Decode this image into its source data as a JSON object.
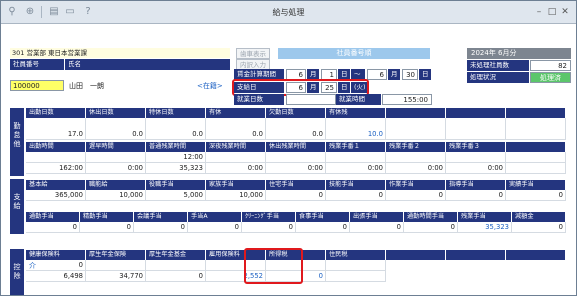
{
  "window": {
    "title": "給与処理"
  },
  "toolbar_icons": [
    "add-user-icon",
    "search-zoom-icon",
    "print-icon",
    "export-icon",
    "help-icon"
  ],
  "employee": {
    "dept": "301 営業部 東日本営業課",
    "code_label": "社員番号",
    "name_label": "氏名",
    "code": "100000",
    "name": "山田　一朗",
    "status_link": "<在籍>"
  },
  "buttons": {
    "rate_display": "歯車表示",
    "ad_input": "内訳入力",
    "sort": "社員番号順"
  },
  "period": {
    "label": "賃金計算期間",
    "from_month": "6",
    "month_unit": "月",
    "from_day": "1",
    "day_unit": "日",
    "tilde": "～",
    "to_month": "6",
    "to_day": "30",
    "pay_label": "支給日",
    "pay_month": "6",
    "pay_day": "25",
    "pay_weekday": "(火)",
    "workdays_label": "就業日数",
    "workhours_label": "就業時間",
    "workhours_value": "155:00"
  },
  "summary": {
    "month": "2024年 6月分",
    "unprocessed_label": "未処理社員数",
    "unprocessed_value": "82",
    "status_label": "処理状況",
    "status_value": "処理済"
  },
  "attendance": {
    "section": "勤怠他",
    "row1_headers": [
      "出勤日数",
      "休出日数",
      "特休日数",
      "有休",
      "欠勤日数",
      "有休残",
      "",
      "",
      ""
    ],
    "row1_values": [
      "17.0",
      "0.0",
      "0.0",
      "0.0",
      "0.0",
      "10.0",
      "",
      "",
      ""
    ],
    "row2_headers": [
      "出勤時間",
      "遅早時間",
      "普通残業時間",
      "深夜残業時間",
      "休出残業時間",
      "残業手番１",
      "残業手番２",
      "残業手番３",
      ""
    ],
    "row2_values": [
      "162:00",
      "0:00",
      "35,323",
      "0:00",
      "0:00",
      "0:00",
      "0:00",
      "0:00",
      ""
    ],
    "row2_sub": [
      "",
      "",
      "12:00",
      "",
      "",
      "",
      "",
      "",
      ""
    ]
  },
  "payment": {
    "section": "支給",
    "row1_headers": [
      "基本給",
      "職能給",
      "役職手当",
      "家族手当",
      "住宅手当",
      "技能手当",
      "作業手当",
      "指導手当",
      "実績手当"
    ],
    "row1_values": [
      "365,000",
      "10,000",
      "5,000",
      "10,000",
      "0",
      "0",
      "0",
      "0",
      "0"
    ],
    "row2_headers": [
      "通勤手当",
      "精勤手当",
      "会議手当",
      "手当A",
      "ｸﾘｰﾆﾝｸﾞ手当",
      "食事手当",
      "出張手当",
      "通勤時間手当",
      "残業手当",
      "減額金"
    ],
    "row2_values": [
      "0",
      "0",
      "0",
      "0",
      "0",
      "0",
      "0",
      "0",
      "35,323",
      "0"
    ]
  },
  "deduction": {
    "section": "控除",
    "sub": "介",
    "headers": [
      "健康保険料",
      "厚生年金保険",
      "厚生年金基金",
      "雇用保険料",
      "所得税",
      "住民税"
    ],
    "values": [
      "6,498",
      "34,770",
      "0",
      "2,552",
      "0",
      ""
    ],
    "top_values": [
      "0",
      "",
      "",
      "",
      "",
      ""
    ]
  }
}
